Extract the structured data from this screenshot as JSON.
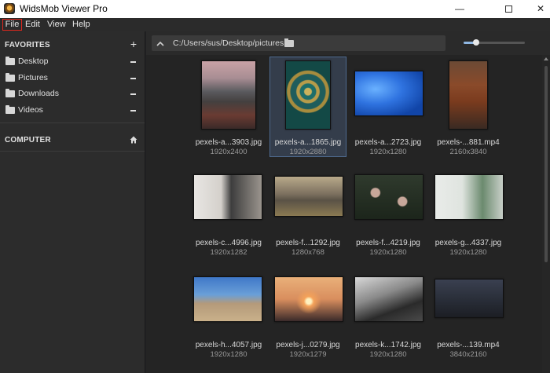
{
  "window": {
    "title": "WidsMob Viewer Pro",
    "minimize": "—",
    "close": "✕"
  },
  "menu": {
    "file": "File",
    "edit": "Edit",
    "view": "View",
    "help": "Help"
  },
  "sidebar": {
    "favorites_label": "FAVORITES",
    "favorites_add": "+",
    "items": [
      {
        "label": "Desktop"
      },
      {
        "label": "Pictures"
      },
      {
        "label": "Downloads"
      },
      {
        "label": "Videos"
      }
    ],
    "computer_label": "COMPUTER"
  },
  "pathbar": {
    "path": "C:/Users/sus/Desktop/pictures",
    "zoom_level": 0.2
  },
  "thumbnails": [
    {
      "name": "pexels-a...3903.jpg",
      "dims": "1920x2400"
    },
    {
      "name": "pexels-a...1865.jpg",
      "dims": "1920x2880",
      "selected": true
    },
    {
      "name": "pexels-a...2723.jpg",
      "dims": "1920x1280"
    },
    {
      "name": "pexels-...881.mp4",
      "dims": "2160x3840"
    },
    {
      "name": "pexels-c...4996.jpg",
      "dims": "1920x1282"
    },
    {
      "name": "pexels-f...1292.jpg",
      "dims": "1280x768"
    },
    {
      "name": "pexels-f...4219.jpg",
      "dims": "1920x1280"
    },
    {
      "name": "pexels-g...4337.jpg",
      "dims": "1920x1280"
    },
    {
      "name": "pexels-h...4057.jpg",
      "dims": "1920x1280"
    },
    {
      "name": "pexels-j...0279.jpg",
      "dims": "1920x1279"
    },
    {
      "name": "pexels-k...1742.jpg",
      "dims": "1920x1280"
    },
    {
      "name": "pexels-...139.mp4",
      "dims": "3840x2160"
    }
  ]
}
